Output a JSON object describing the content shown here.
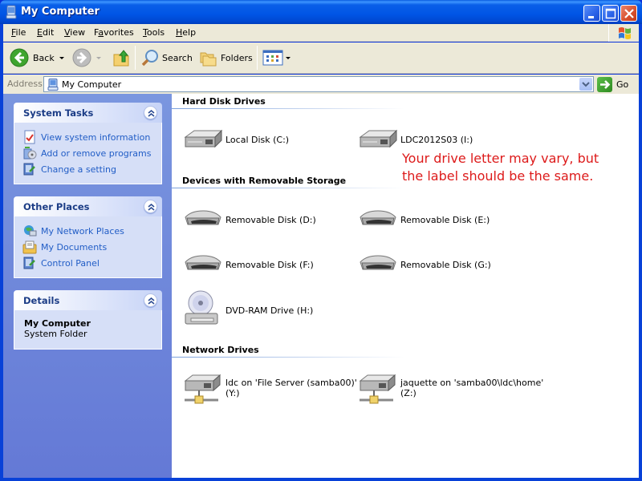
{
  "window": {
    "title": "My Computer",
    "controls": {
      "minimize": "minimize",
      "maximize": "maximize",
      "close": "close"
    }
  },
  "menubar": {
    "items": [
      {
        "label": "File",
        "accel": "F"
      },
      {
        "label": "Edit",
        "accel": "E"
      },
      {
        "label": "View",
        "accel": "V"
      },
      {
        "label": "Favorites",
        "accel": "a"
      },
      {
        "label": "Tools",
        "accel": "T"
      },
      {
        "label": "Help",
        "accel": "H"
      }
    ]
  },
  "toolbar": {
    "back_label": "Back",
    "search_label": "Search",
    "folders_label": "Folders"
  },
  "addressbar": {
    "label": "Address",
    "value": "My Computer",
    "go_label": "Go"
  },
  "sidebar": {
    "system_tasks": {
      "title": "System Tasks",
      "items": [
        {
          "label": "View system information",
          "icon": "system-info-icon"
        },
        {
          "label": "Add or remove programs",
          "icon": "add-remove-programs-icon"
        },
        {
          "label": "Change a setting",
          "icon": "control-panel-icon"
        }
      ]
    },
    "other_places": {
      "title": "Other Places",
      "items": [
        {
          "label": "My Network Places",
          "icon": "network-places-icon"
        },
        {
          "label": "My Documents",
          "icon": "my-documents-icon"
        },
        {
          "label": "Control Panel",
          "icon": "control-panel-icon"
        }
      ]
    },
    "details": {
      "title": "Details",
      "name": "My Computer",
      "type": "System Folder"
    }
  },
  "main": {
    "groups": [
      {
        "title": "Hard Disk Drives",
        "drives": [
          {
            "label": "Local Disk (C:)",
            "icon": "hard-disk-icon"
          },
          {
            "label": "LDC2012S03 (I:)",
            "icon": "hard-disk-icon"
          }
        ]
      },
      {
        "title": "Devices with Removable Storage",
        "drives": [
          {
            "label": "Removable Disk (D:)",
            "icon": "removable-disk-icon"
          },
          {
            "label": "Removable Disk (E:)",
            "icon": "removable-disk-icon"
          },
          {
            "label": "Removable Disk (F:)",
            "icon": "removable-disk-icon"
          },
          {
            "label": "Removable Disk (G:)",
            "icon": "removable-disk-icon"
          },
          {
            "label": "DVD-RAM Drive (H:)",
            "icon": "dvd-drive-icon"
          }
        ]
      },
      {
        "title": "Network Drives",
        "drives": [
          {
            "label": "ldc on 'File Server (samba00)'\n(Y:)",
            "icon": "network-drive-icon"
          },
          {
            "label": "jaquette on 'samba00\\ldc\\home'\n(Z:)",
            "icon": "network-drive-icon"
          }
        ]
      }
    ],
    "annotation": "Your drive letter may vary, but the label should be the same.",
    "annotation_color": "#dd1a1a"
  }
}
